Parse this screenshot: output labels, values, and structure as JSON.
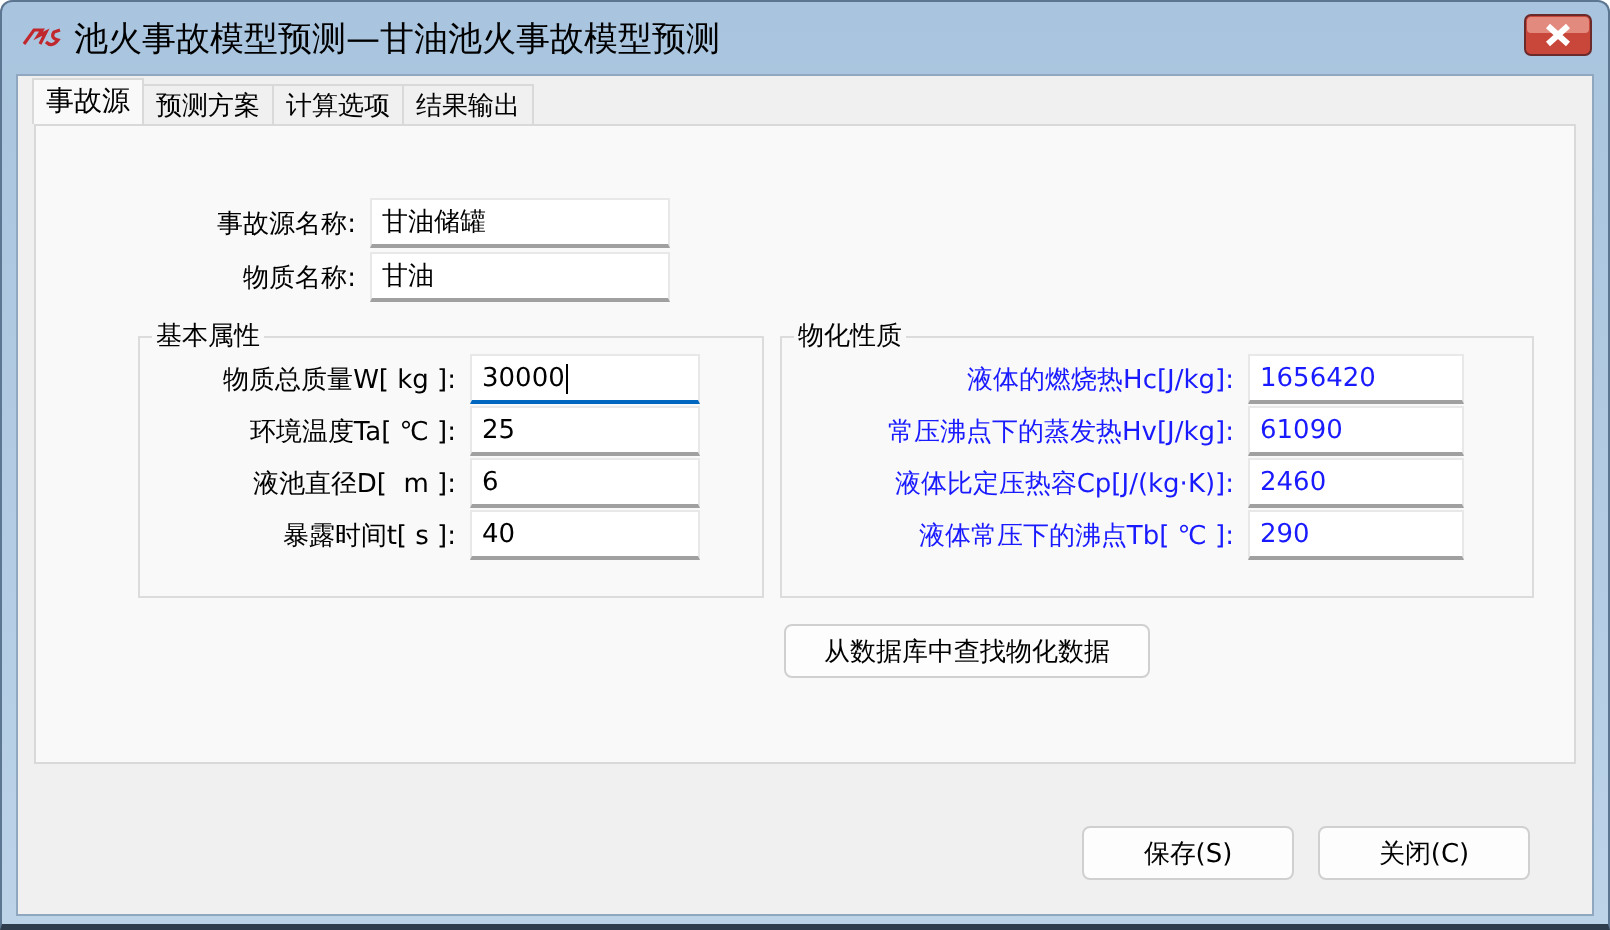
{
  "window": {
    "title": "池火事故模型预测—甘油池火事故模型预测"
  },
  "tabs": [
    {
      "label": "事故源",
      "selected": true
    },
    {
      "label": "预测方案",
      "selected": false
    },
    {
      "label": "计算选项",
      "selected": false
    },
    {
      "label": "结果输出",
      "selected": false
    }
  ],
  "source": [
    {
      "label": "事故源名称:",
      "value": "甘油储罐"
    },
    {
      "label": "物质名称:",
      "value": "甘油"
    }
  ],
  "groups": [
    {
      "title": "基本属性",
      "kind": "input",
      "fields": [
        {
          "label": "物质总质量W[ kg ]:",
          "value": "30000",
          "focused": true
        },
        {
          "label": "环境温度Ta[ ℃ ]:",
          "value": "25",
          "focused": false
        },
        {
          "label": "液池直径D[  m ]:",
          "value": "6",
          "focused": false
        },
        {
          "label": "暴露时间t[ s ]:",
          "value": "40",
          "focused": false
        }
      ]
    },
    {
      "title": "物化性质",
      "kind": "reference",
      "button": "从数据库中查找物化数据",
      "fields": [
        {
          "label": "液体的燃烧热Hc[J/kg]:",
          "value": "1656420",
          "focused": false
        },
        {
          "label": "常压沸点下的蒸发热Hv[J/kg]:",
          "value": "61090",
          "focused": false
        },
        {
          "label": "液体比定压热容Cp[J/(kg·K)]:",
          "value": "2460",
          "focused": false
        },
        {
          "label": "液体常压下的沸点Tb[ ℃ ]:",
          "value": "290",
          "focused": false
        }
      ]
    }
  ],
  "buttons": [
    "保存(S)",
    "关闭(C)"
  ]
}
